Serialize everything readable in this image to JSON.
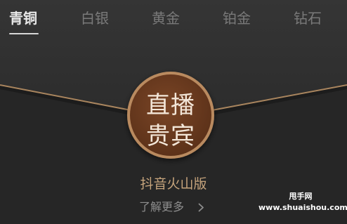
{
  "tabs": [
    {
      "label": "青铜",
      "active": true
    },
    {
      "label": "白银",
      "active": false
    },
    {
      "label": "黄金",
      "active": false
    },
    {
      "label": "铂金",
      "active": false
    },
    {
      "label": "钻石",
      "active": false
    }
  ],
  "card": {
    "seal_line1": "直播",
    "seal_line2": "贵宾",
    "subtitle": "抖音火山版",
    "learn_more": "了解更多",
    "icon": "chevron-right-icon"
  },
  "watermark": {
    "line1": "甩手网",
    "line2": "www.shuaishou.com"
  },
  "colors": {
    "background": "#252525",
    "medallion": "#6b3b1e",
    "medallion_ring": "#b98a5e",
    "gold_line": "#a9855e",
    "subtitle": "#c6a47c"
  }
}
